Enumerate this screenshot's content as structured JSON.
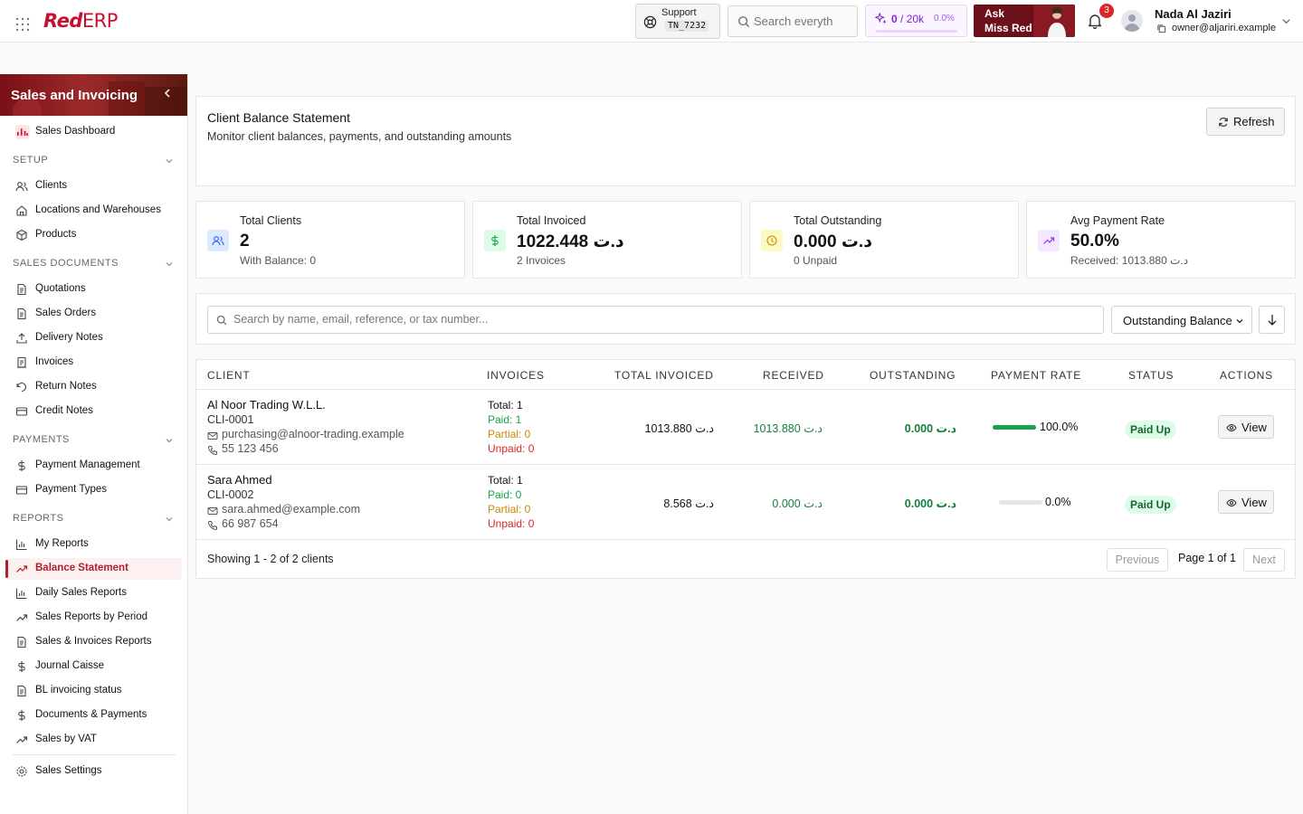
{
  "app": {
    "logo_red": "Red",
    "logo_erp": "ERP"
  },
  "topbar": {
    "support_label": "Support",
    "support_code": "TN_7232",
    "search_placeholder": "Search everyth",
    "usage_used": "0",
    "usage_sep": " / ",
    "usage_limit": "20k",
    "usage_pct": "0.0%",
    "ask_line1": "Ask",
    "ask_line2": "Miss Red",
    "notifications_count": "3",
    "user_name": "Nada Al Jaziri",
    "user_email": "owner@aljariri.example"
  },
  "sidebar": {
    "module_title": "Sales and Invoicing",
    "dashboard": "Sales Dashboard",
    "sections": {
      "setup": "SETUP",
      "sales_documents": "SALES DOCUMENTS",
      "payments": "PAYMENTS",
      "reports": "REPORTS"
    },
    "setup_items": [
      {
        "label": "Clients",
        "icon": "users-icon"
      },
      {
        "label": "Locations and Warehouses",
        "icon": "home-icon"
      },
      {
        "label": "Products",
        "icon": "package-icon"
      }
    ],
    "document_items": [
      {
        "label": "Quotations",
        "icon": "file-icon"
      },
      {
        "label": "Sales Orders",
        "icon": "file-icon"
      },
      {
        "label": "Delivery Notes",
        "icon": "upload-icon"
      },
      {
        "label": "Invoices",
        "icon": "receipt-icon"
      },
      {
        "label": "Return Notes",
        "icon": "rotate-icon"
      },
      {
        "label": "Credit Notes",
        "icon": "card-icon"
      }
    ],
    "payment_items": [
      {
        "label": "Payment Management",
        "icon": "dollar-icon"
      },
      {
        "label": "Payment Types",
        "icon": "card-icon"
      }
    ],
    "report_items": [
      {
        "label": "My Reports",
        "icon": "bar-chart-icon"
      },
      {
        "label": "Balance Statement",
        "icon": "trending-up-icon",
        "active": true
      },
      {
        "label": "Daily Sales Reports",
        "icon": "bar-chart-icon"
      },
      {
        "label": "Sales Reports by Period",
        "icon": "trending-up-icon"
      },
      {
        "label": "Sales & Invoices Reports",
        "icon": "file-icon"
      },
      {
        "label": "Journal Caisse",
        "icon": "dollar-icon"
      },
      {
        "label": "BL invoicing status",
        "icon": "file-icon"
      },
      {
        "label": "Documents & Payments",
        "icon": "dollar-icon"
      },
      {
        "label": "Sales by VAT",
        "icon": "trending-up-icon"
      }
    ],
    "settings": "Sales Settings"
  },
  "page": {
    "title": "Client Balance Statement",
    "subtitle": "Monitor client balances, payments, and outstanding amounts",
    "refresh_label": "Refresh"
  },
  "stats": [
    {
      "label": "Total Clients",
      "value": "2",
      "sub": "With Balance: 0",
      "color": "#dbeafe",
      "icon": "users-icon"
    },
    {
      "label": "Total Invoiced",
      "value": "1022.448 د.ت",
      "sub": "2 Invoices",
      "color": "#dcfce7",
      "icon": "dollar-icon"
    },
    {
      "label": "Total Outstanding",
      "value": "0.000 د.ت",
      "sub": "0 Unpaid",
      "color": "#fef9c3",
      "icon": "clock-icon"
    },
    {
      "label": "Avg Payment Rate",
      "value": "50.0%",
      "sub": "Received: 1013.880 د.ت",
      "color": "#f3e8ff",
      "icon": "trending-up-icon"
    }
  ],
  "filters": {
    "search_placeholder": "Search by name, email, reference, or tax number...",
    "sort_label": "Outstanding Balance"
  },
  "table": {
    "columns": [
      "CLIENT",
      "INVOICES",
      "TOTAL INVOICED",
      "RECEIVED",
      "OUTSTANDING",
      "PAYMENT RATE",
      "STATUS",
      "ACTIONS"
    ],
    "rows": [
      {
        "name": "Al Noor Trading W.L.L.",
        "code": "CLI-0001",
        "email": "purchasing@alnoor-trading.example",
        "phone": "55 123 456",
        "inv_total": "Total: 1",
        "inv_paid": "Paid: 1",
        "inv_partial": "Partial: 0",
        "inv_unpaid": "Unpaid: 0",
        "total_invoiced": "1013.880 د.ت",
        "received": "1013.880 د.ت",
        "outstanding": "0.000 د.ت",
        "rate_text": "100.0%",
        "rate": 1.0,
        "status": "Paid Up",
        "action": "View"
      },
      {
        "name": "Sara Ahmed",
        "code": "CLI-0002",
        "email": "sara.ahmed@example.com",
        "phone": "66 987 654",
        "inv_total": "Total: 1",
        "inv_paid": "Paid: 0",
        "inv_partial": "Partial: 0",
        "inv_unpaid": "Unpaid: 0",
        "total_invoiced": "8.568 د.ت",
        "received": "0.000 د.ت",
        "outstanding": "0.000 د.ت",
        "rate_text": "0.0%",
        "rate": 0.0,
        "status": "Paid Up",
        "action": "View"
      }
    ],
    "showing": "Showing 1 - 2 of 2 clients",
    "previous": "Previous",
    "page_info": "Page 1 of 1",
    "next": "Next"
  },
  "colors": {
    "brand": "#c8102e",
    "active": "#b01f2c",
    "success": "#16a34a"
  }
}
